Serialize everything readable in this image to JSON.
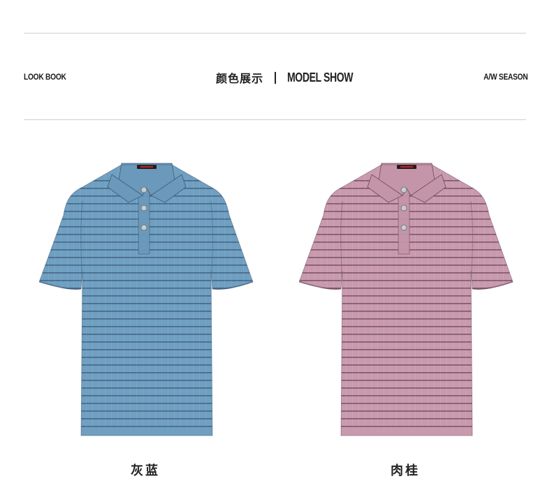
{
  "header": {
    "left_label": "LOOK BOOK",
    "center_cn": "颜色展示",
    "center_en": "MODEL SHOW",
    "right_label": "A/W SEASON"
  },
  "products": [
    {
      "caption": "灰蓝",
      "body_color": "#6f9fc1",
      "stripe_color": "#3f5a78",
      "collar_color": "#6a99bb",
      "icon": "polo-shirt-icon"
    },
    {
      "caption": "肉桂",
      "body_color": "#c99aae",
      "stripe_color": "#6e4a5c",
      "collar_color": "#c494a8",
      "icon": "polo-shirt-icon"
    }
  ]
}
